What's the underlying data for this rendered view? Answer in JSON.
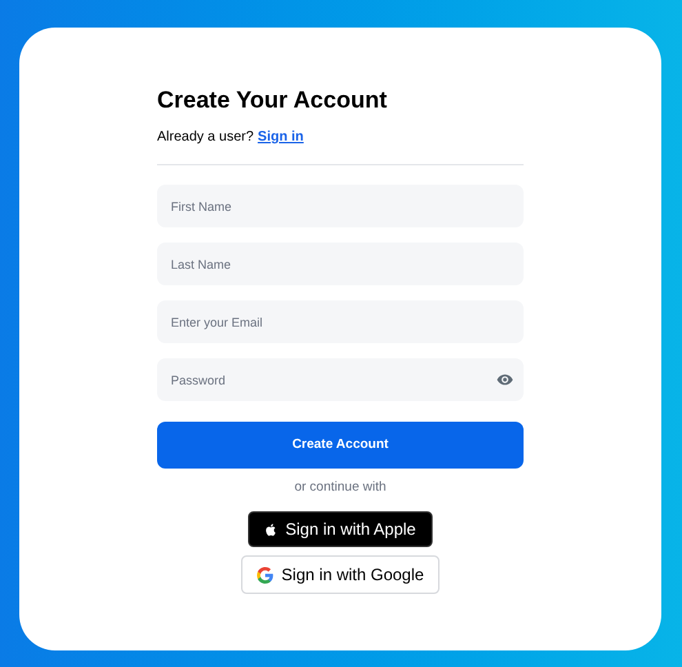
{
  "title": "Create Your Account",
  "signin_prompt": {
    "text": "Already a user?",
    "link": "Sign in"
  },
  "fields": [
    {
      "kind": "text",
      "placeholder": "First Name"
    },
    {
      "kind": "text",
      "placeholder": "Last Name"
    },
    {
      "kind": "email",
      "placeholder": "Enter your Email"
    },
    {
      "kind": "password",
      "placeholder": "Password"
    }
  ],
  "submit": "Create Account",
  "divider_text": "or continue with",
  "social_buttons": [
    {
      "kind": "apple",
      "label": "Sign in with Apple"
    },
    {
      "kind": "google",
      "label": "Sign in with Google"
    }
  ]
}
